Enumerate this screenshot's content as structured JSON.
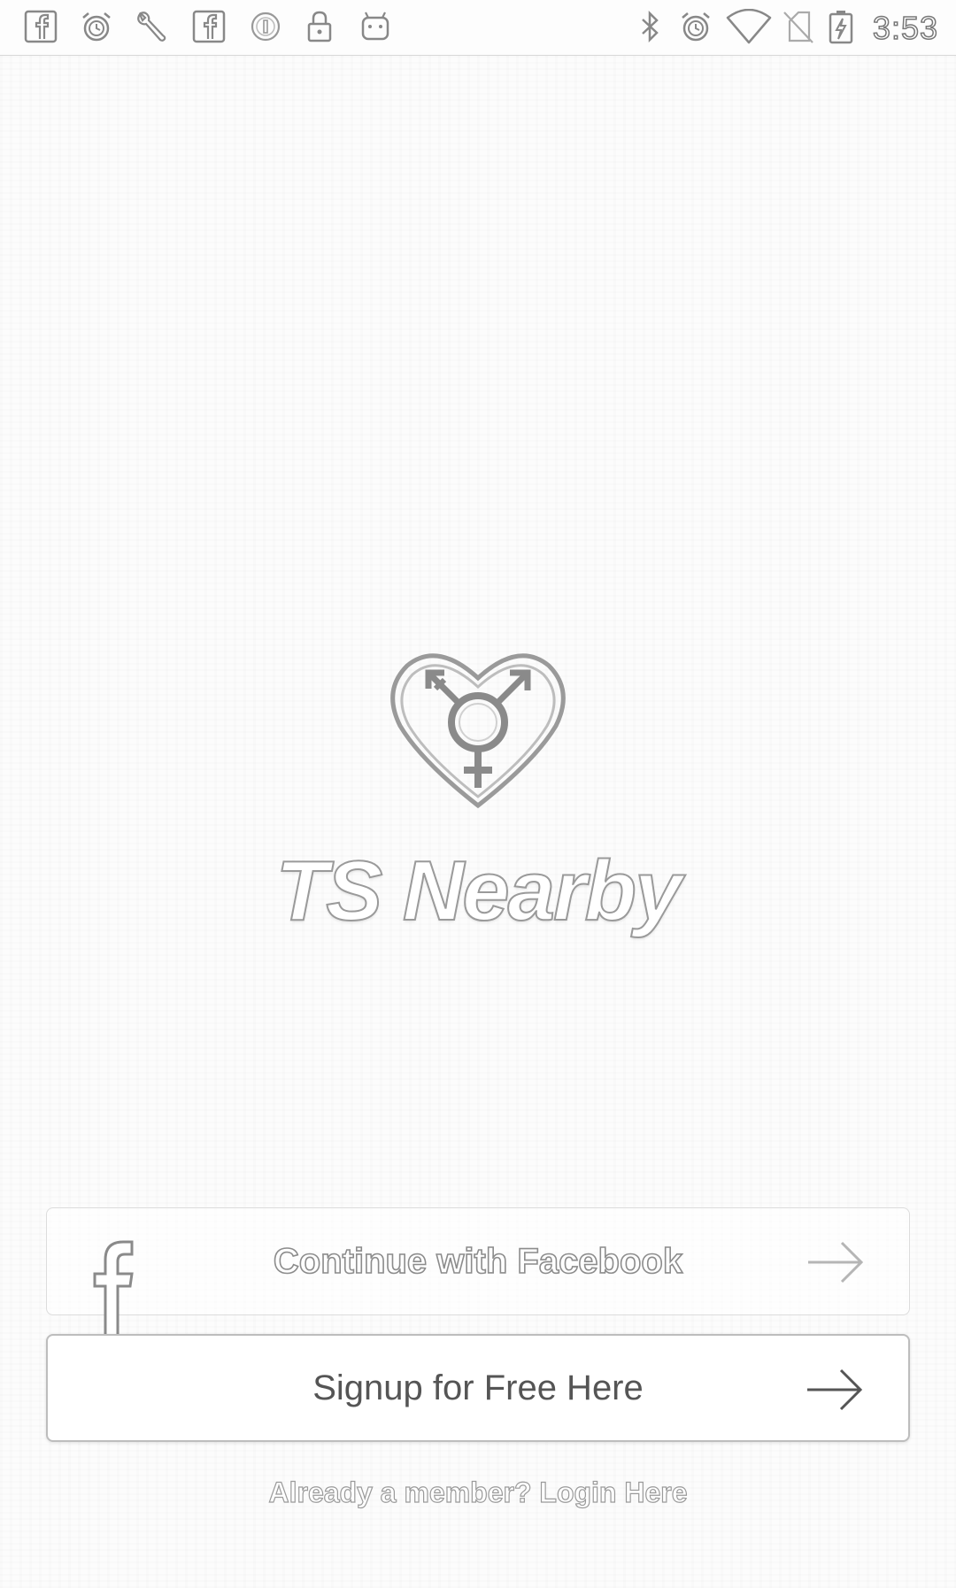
{
  "status_bar": {
    "left_icons": [
      "facebook-icon",
      "alarm-icon",
      "wrench-icon",
      "facebook-icon",
      "circle-info-icon",
      "lock-icon",
      "android-icon"
    ],
    "right_icons": [
      "bluetooth-icon",
      "alarm-icon",
      "wifi-icon",
      "no-sim-icon",
      "battery-charging-icon"
    ],
    "time": "3:53"
  },
  "app": {
    "logo_icon": "transgender-heart-icon",
    "name": "TS Nearby"
  },
  "buttons": {
    "facebook_label": "Continue with Facebook",
    "facebook_icon": "facebook-f-icon",
    "signup_label": "Signup for Free Here",
    "arrow_icon": "arrow-right-icon"
  },
  "login_link": "Already a member? Login Here"
}
